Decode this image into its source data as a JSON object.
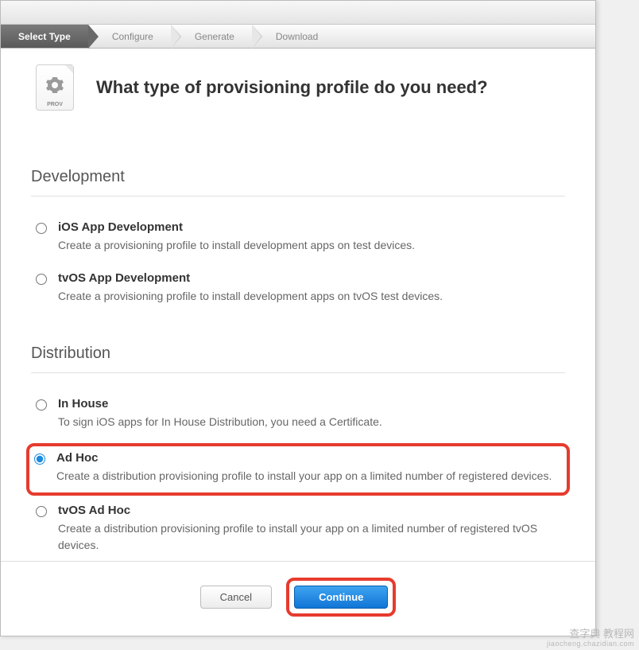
{
  "steps": {
    "select_type": "Select Type",
    "configure": "Configure",
    "generate": "Generate",
    "download": "Download"
  },
  "icon_label": "PROV",
  "page_title": "What type of provisioning profile do you need?",
  "sections": {
    "development": {
      "title": "Development",
      "ios_app_dev": {
        "title": "iOS App Development",
        "desc": "Create a provisioning profile to install development apps on test devices."
      },
      "tvos_app_dev": {
        "title": "tvOS App Development",
        "desc": "Create a provisioning profile to install development apps on tvOS test devices."
      }
    },
    "distribution": {
      "title": "Distribution",
      "in_house": {
        "title": "In House",
        "desc": "To sign iOS apps for In House Distribution, you need a Certificate."
      },
      "ad_hoc": {
        "title": "Ad Hoc",
        "desc": "Create a distribution provisioning profile to install your app on a limited number of registered devices."
      },
      "tvos_ad_hoc": {
        "title": "tvOS Ad Hoc",
        "desc": "Create a distribution provisioning profile to install your app on a limited number of registered tvOS devices."
      }
    }
  },
  "buttons": {
    "cancel": "Cancel",
    "continue": "Continue"
  },
  "selected_option": "ad_hoc",
  "watermark": {
    "main": "查字典 教程网",
    "sub": "jiaocheng.chazidian.com"
  }
}
